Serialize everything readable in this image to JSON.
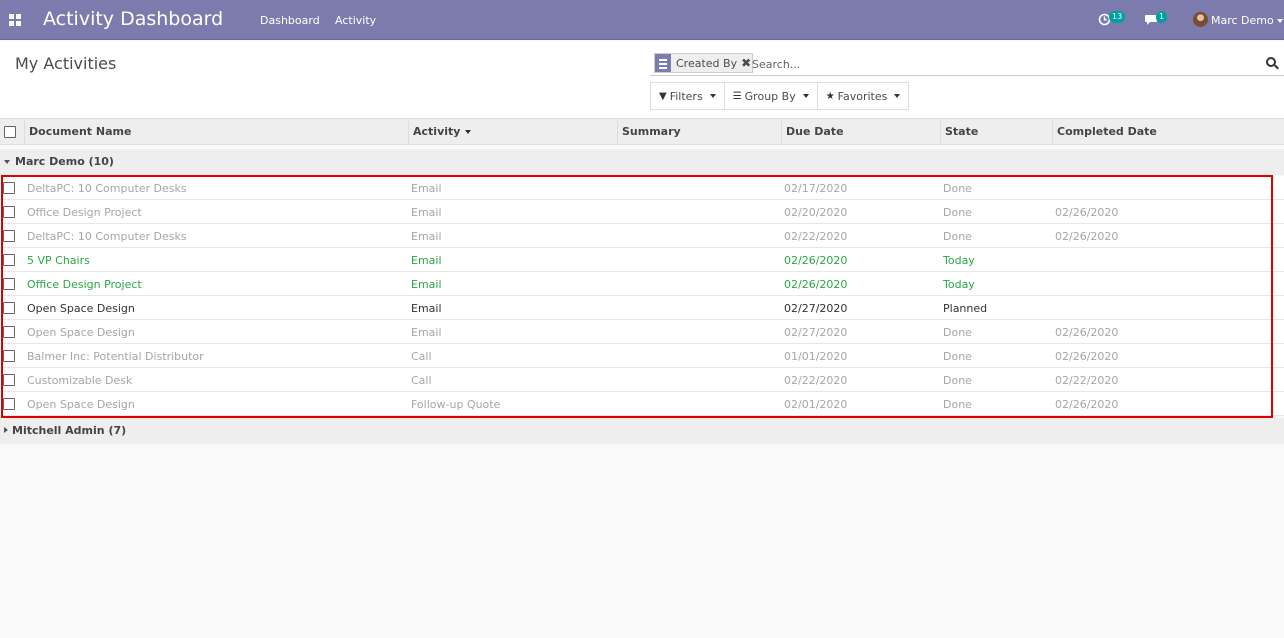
{
  "navbar": {
    "app_title": "Activity Dashboard",
    "menu": [
      "Dashboard",
      "Activity"
    ],
    "activity_count": "13",
    "message_count": "1",
    "user_name": "Marc Demo"
  },
  "panel": {
    "title": "My Activities",
    "facet_label": "Created By",
    "search_placeholder": "Search...",
    "filters_label": "Filters",
    "groupby_label": "Group By",
    "favorites_label": "Favorites"
  },
  "table": {
    "headers": [
      "Document Name",
      "Activity",
      "Summary",
      "Due Date",
      "State",
      "Completed Date"
    ],
    "groups": [
      {
        "label": "Marc Demo (10)",
        "expanded": true,
        "rows": [
          {
            "document": "DeltaPC: 10 Computer Desks",
            "activity": "Email",
            "summary": "",
            "due": "02/17/2020",
            "state": "Done",
            "completed": "",
            "status": "done"
          },
          {
            "document": "Office Design Project",
            "activity": "Email",
            "summary": "",
            "due": "02/20/2020",
            "state": "Done",
            "completed": "02/26/2020",
            "status": "done"
          },
          {
            "document": "DeltaPC: 10 Computer Desks",
            "activity": "Email",
            "summary": "",
            "due": "02/22/2020",
            "state": "Done",
            "completed": "02/26/2020",
            "status": "done"
          },
          {
            "document": "5 VP Chairs",
            "activity": "Email",
            "summary": "",
            "due": "02/26/2020",
            "state": "Today",
            "completed": "",
            "status": "today"
          },
          {
            "document": "Office Design Project",
            "activity": "Email",
            "summary": "",
            "due": "02/26/2020",
            "state": "Today",
            "completed": "",
            "status": "today"
          },
          {
            "document": "Open Space Design",
            "activity": "Email",
            "summary": "",
            "due": "02/27/2020",
            "state": "Planned",
            "completed": "",
            "status": "planned"
          },
          {
            "document": "Open Space Design",
            "activity": "Email",
            "summary": "",
            "due": "02/27/2020",
            "state": "Done",
            "completed": "02/26/2020",
            "status": "done"
          },
          {
            "document": "Balmer Inc: Potential Distributor",
            "activity": "Call",
            "summary": "",
            "due": "01/01/2020",
            "state": "Done",
            "completed": "02/26/2020",
            "status": "done"
          },
          {
            "document": "Customizable Desk",
            "activity": "Call",
            "summary": "",
            "due": "02/22/2020",
            "state": "Done",
            "completed": "02/22/2020",
            "status": "done"
          },
          {
            "document": "Open Space Design",
            "activity": "Follow-up Quote",
            "summary": "",
            "due": "02/01/2020",
            "state": "Done",
            "completed": "02/26/2020",
            "status": "done"
          }
        ]
      },
      {
        "label": "Mitchell Admin (7)",
        "expanded": false,
        "rows": []
      }
    ]
  },
  "colors": {
    "brand": "#7c7bad",
    "done_text": "#a6a6a6",
    "today_text": "#28a745",
    "highlight": "#e00000",
    "badge": "#00a09d"
  }
}
